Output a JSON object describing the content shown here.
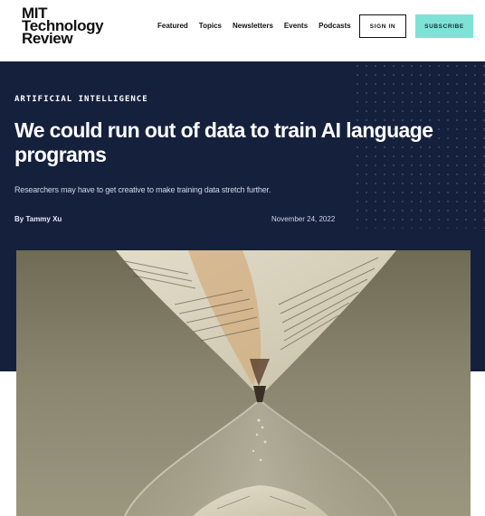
{
  "header": {
    "logo": {
      "line1": "MIT",
      "line2": "Technology",
      "line3": "Review"
    },
    "nav": [
      {
        "label": "Featured"
      },
      {
        "label": "Topics"
      },
      {
        "label": "Newsletters"
      },
      {
        "label": "Events"
      },
      {
        "label": "Podcasts"
      }
    ],
    "signin_label": "SIGN IN",
    "subscribe_label": "SUBSCRIBE"
  },
  "article": {
    "kicker": "ARTIFICIAL INTELLIGENCE",
    "headline": "We could run out of data to train AI language programs",
    "dek": "Researchers may have to get creative to make training data stretch further.",
    "byline": "By Tammy Xu",
    "date": "November 24, 2022"
  },
  "colors": {
    "hero_background": "#15203d",
    "subscribe_button": "#7fe2d7"
  },
  "hero_image": {
    "icon": "hourglass-with-newspaper-sand"
  }
}
